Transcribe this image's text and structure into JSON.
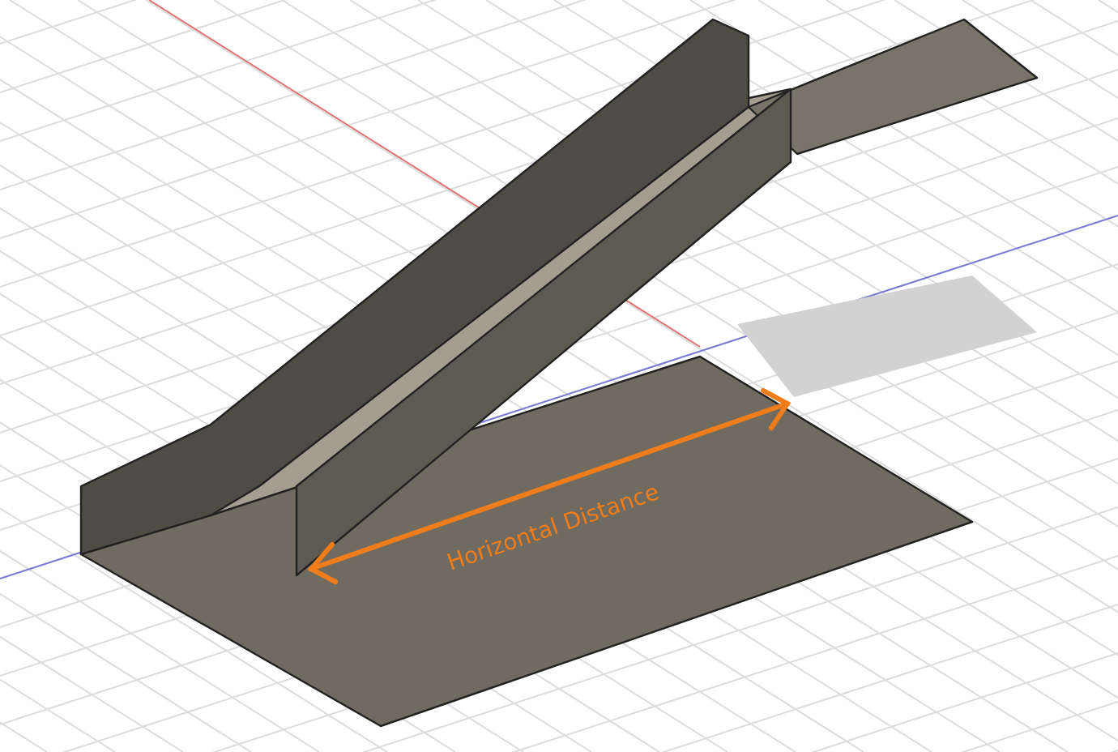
{
  "dimension": {
    "label": "Horizontal Distance"
  }
}
